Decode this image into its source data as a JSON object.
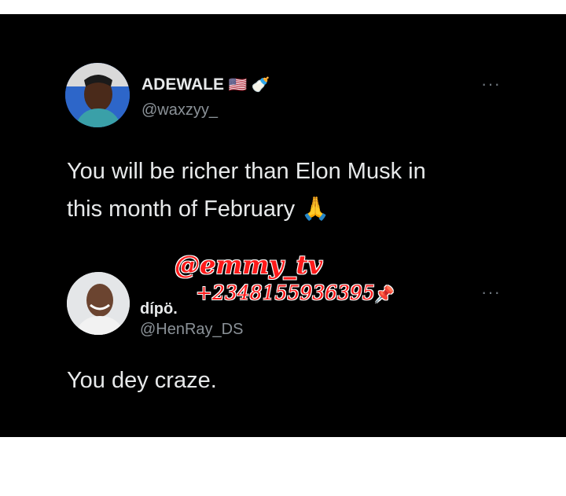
{
  "tweet": {
    "author_name": "ADEWALE",
    "author_handle": "@waxzyy_",
    "name_emojis": "🇺🇸 🍼",
    "body_line1": "You will be richer than Elon Musk in",
    "body_line2": "this month of February",
    "body_emoji": "🙏",
    "more_icon": "more-icon"
  },
  "reply": {
    "author_name": "dípö.",
    "author_handle": "@HenRay_DS",
    "body": "You dey craze.",
    "more_icon": "more-icon"
  },
  "watermark": {
    "name": "@emmy_tv",
    "phone": "+2348155936395",
    "pin": "📌"
  },
  "colors": {
    "background": "#000000",
    "text": "#e7e9ea",
    "muted": "#8b9298",
    "watermark": "#ff1a1a"
  }
}
